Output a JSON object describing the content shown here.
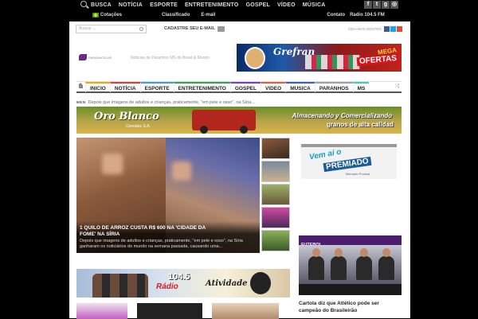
{
  "topbar": {
    "nav": [
      "BUSCA",
      "NOTÍCIA",
      "ESPORTE",
      "ENTRETENIMENTO",
      "GOSPEL",
      "VÍDEO",
      "MÚSICA"
    ],
    "cotacoes": "Cotações",
    "classificado": "Classificado",
    "email": "E-mail",
    "contato": "Contato",
    "radio": "Radio 104.5 FM",
    "social_icons": [
      "facebook-icon",
      "twitter-icon",
      "googleplus-icon",
      "instagram-icon"
    ]
  },
  "header": {
    "search_placeholder": "Buscar ...",
    "cadastre": "CADASTRE SEU E-MAIL",
    "siga": "SIGA-NOS DENTRO",
    "tagline": "Notícias de Paranhos MS do Brasil & Mundo",
    "logo_text": "PARANHOS MS"
  },
  "ad_top": {
    "brand": "Grefran",
    "line1": "MEGA",
    "line2": "OFERTAS"
  },
  "mainnav": {
    "items": [
      "INICIO",
      "NOTÍCIA",
      "ESPORTE",
      "ENTRETENIMENTO",
      "GOSPEL",
      "VIDEO",
      "MUSICA",
      "PARANHOS",
      "MS"
    ],
    "colors": [
      "#f2a900",
      "#e03a3a",
      "#3aa0e0",
      "#2aa84a",
      "#7a3ad0",
      "#e0603a",
      "#3a5ae0",
      "#a0a0a0",
      "#3ad0c0"
    ]
  },
  "ticker": {
    "label": "MEN",
    "text": "Depois que imagens de adultos e crianças, praticamente, \"em pele e osso\", na Síria..."
  },
  "ad_oro": {
    "title": "Oro Blanco",
    "sub": "Cereales S.A.",
    "line1": "Almacenando y Comercializando",
    "line2": "granos de alta calidad"
  },
  "featured": {
    "title": "1 QUILO DE ARROZ CUSTA R$ 600 NA 'CIDADE DA FOME' NA SÍRIA",
    "excerpt": "Depois que imagens de adultos e crianças, praticamente, \"em pele e osso\", na Síria ganharam os noticiários do mundo na semana passada, causando uma..."
  },
  "right": {
    "ad_line1": "Vem aí o",
    "ad_line2": "PREMIADO",
    "ad_line3": "Mercado Pontual",
    "futebol_label": "FUTEBOL",
    "futebol_title": "Cartola diz que Atlético pode ser campeão do Brasileirão"
  },
  "ad_fm": {
    "freq": "104.5",
    "radio": "Rádio",
    "name": "Atividade FM"
  }
}
